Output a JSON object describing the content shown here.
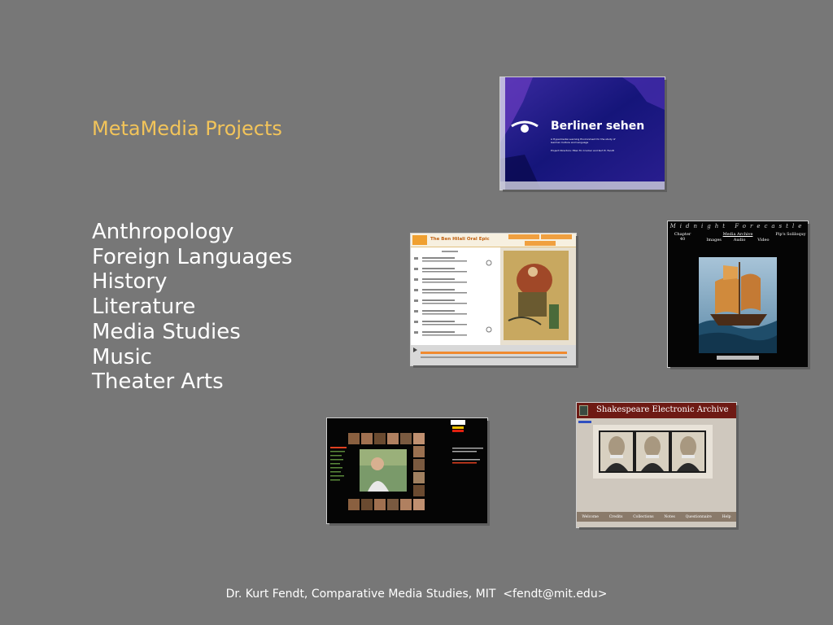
{
  "slide": {
    "title": "MetaMedia Projects",
    "subjects": [
      "Anthropology",
      "Foreign Languages",
      "History",
      "Literature",
      "Media Studies",
      "Music",
      "Theater Arts"
    ],
    "footer": "Dr. Kurt Fendt, Comparative Media Studies, MIT  <fendt@mit.edu>"
  },
  "thumbnails": {
    "berliner": {
      "title": "Berliner sehen",
      "tagline": "A Hypermedia Learning Environment for the study of German Culture and Language",
      "credits": "Project Directors: Ellen M. Crocker and Kurt E. Fendt"
    },
    "epic": {
      "title": "The Ben Hilali Oral Epic"
    },
    "forecastle": {
      "banner": "Midnight Forecastle",
      "left": "Chapter 40",
      "center": "Media Archive",
      "right": "Pip's Soliloquy",
      "menu": [
        "Images",
        "Audio",
        "Video"
      ]
    },
    "shakespeare": {
      "title": "Shakespeare Electronic Archive",
      "nav": [
        "Welcome",
        "Credits",
        "Collections",
        "Notes",
        "Questionnaire",
        "Help"
      ]
    }
  },
  "colors": {
    "background": "#777777",
    "title": "#f2c45a",
    "text": "#ffffff"
  }
}
